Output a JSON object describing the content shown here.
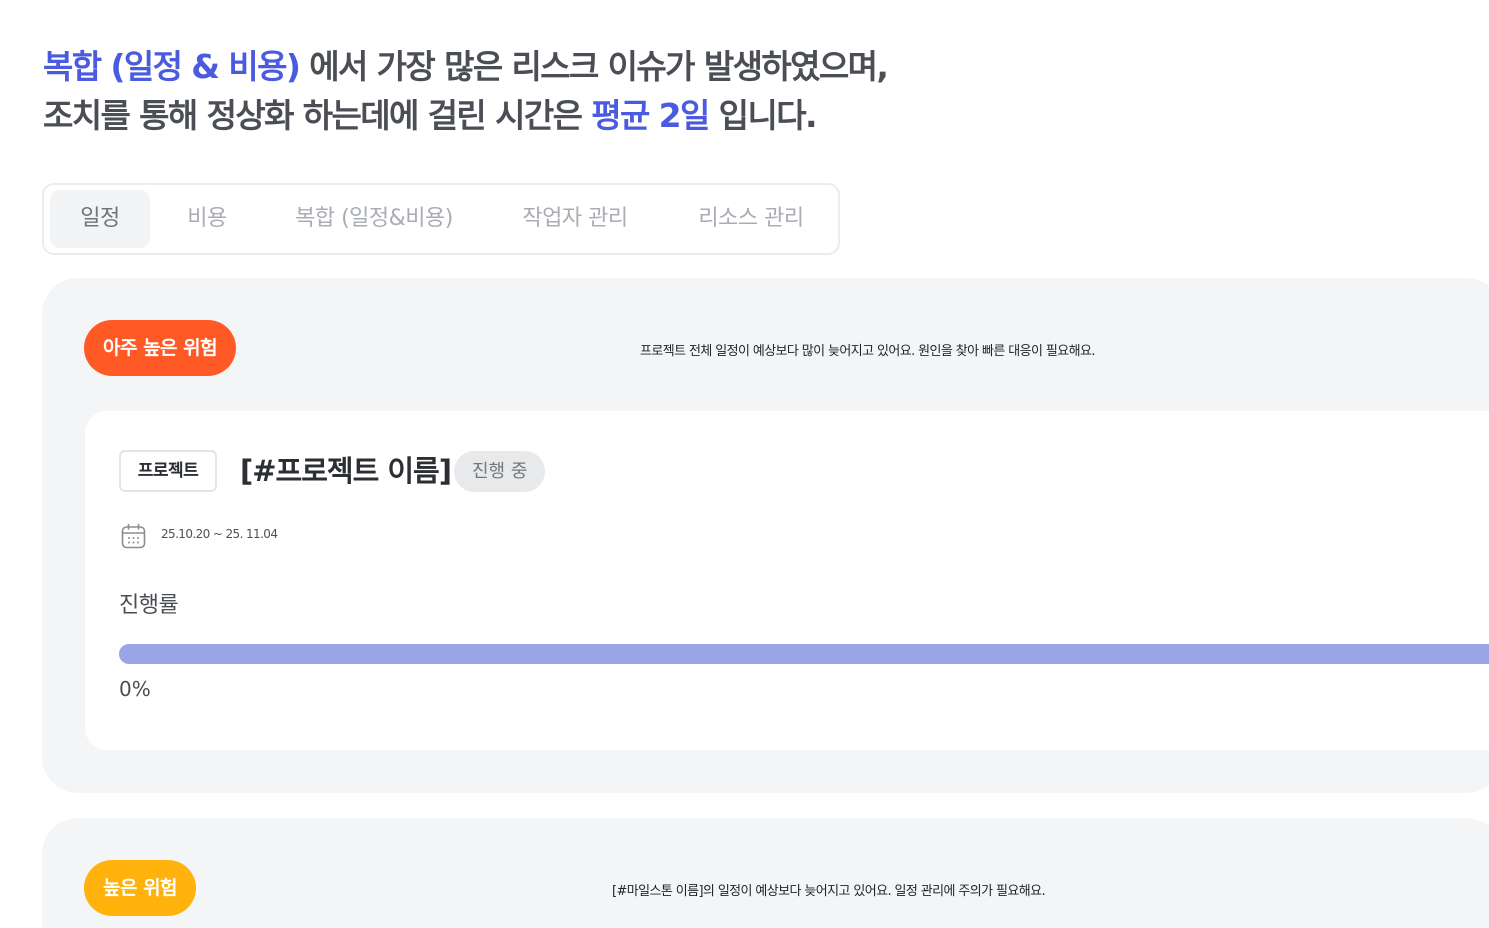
{
  "headline": {
    "line1_highlight": "복합 (일정 & 비용)",
    "line1_rest": " 에서 가장 많은 리스크 이슈가 발생하였으며,",
    "line2_start": "조치를 통해 정상화 하는데에 걸린 시간은 ",
    "line2_highlight": "평균 2일",
    "line2_end": " 입니다."
  },
  "tabs": [
    {
      "label": "일정",
      "active": true
    },
    {
      "label": "비용",
      "active": false
    },
    {
      "label": "복합 (일정&비용)",
      "active": false
    },
    {
      "label": "작업자 관리",
      "active": false
    },
    {
      "label": "리소스 관리",
      "active": false
    }
  ],
  "risk_groups": [
    {
      "badge": "아주 높은 위험",
      "badge_color": "#ff5a26",
      "message": "프로젝트 전체 일정이 예상보다 많이 늦어지고 있어요. 원인을 찾아 빠른 대응이 필요해요.",
      "project": {
        "type": "프로젝트",
        "name": "[#프로젝트 이름]",
        "status": "진행 중",
        "date_icon": "calendar-icon",
        "date_range": "25.10.20 ~ 25. 11.04",
        "progress_label": "진행률",
        "progress_percent": 0,
        "progress_text": "0%"
      }
    },
    {
      "badge": "높은 위험",
      "badge_color": "#ffb20c",
      "message": "[#마일스톤 이름]의 일정이 예상보다 늦어지고 있어요. 일정 관리에 주의가 필요해요."
    }
  ],
  "colors": {
    "accent": "#4a5be0",
    "progress_track": "#99a5e7",
    "panel_bg": "#f4f5f6"
  }
}
